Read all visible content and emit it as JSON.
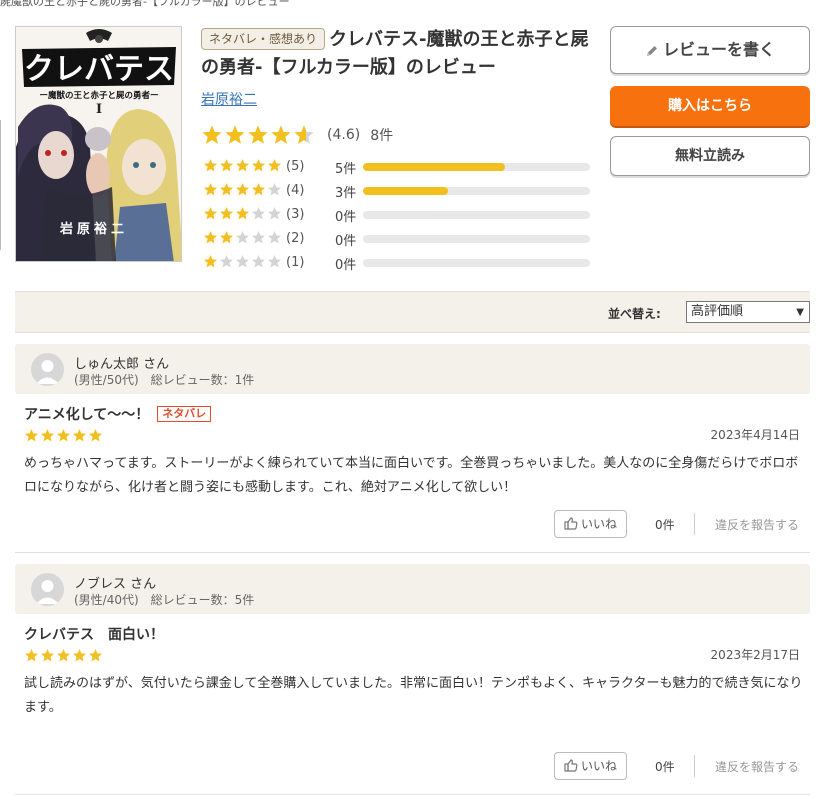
{
  "breadcrumb": "屍魔獣の王と赤子と屍の勇者-【フルカラー版】のレビュー",
  "book": {
    "spoiler_tag": "ネタバレ・感想あり",
    "title": "クレバテス-魔獣の王と赤子と屍の勇者-【フルカラー版】のレビュー",
    "author": "岩原裕二",
    "average": "(4.6)",
    "count": "8件",
    "rating_value": 4.6,
    "cover": {
      "logo": "クレバテス",
      "subtitle": "ー魔獣の王と赤子と屍の勇者ー",
      "volume": "I",
      "author_mark": "岩原裕二"
    }
  },
  "distribution": [
    {
      "stars": 5,
      "label": "(5)",
      "count": "5件",
      "fraction": 0.625
    },
    {
      "stars": 4,
      "label": "(4)",
      "count": "3件",
      "fraction": 0.375
    },
    {
      "stars": 3,
      "label": "(3)",
      "count": "0件",
      "fraction": 0
    },
    {
      "stars": 2,
      "label": "(2)",
      "count": "0件",
      "fraction": 0
    },
    {
      "stars": 1,
      "label": "(1)",
      "count": "0件",
      "fraction": 0
    }
  ],
  "buttons": {
    "write_review": "レビューを書く",
    "buy": "購入はこちら",
    "free_read": "無料立読み"
  },
  "sort": {
    "label": "並べ替え:",
    "selected": "高評価順"
  },
  "reviews": [
    {
      "name": "しゅん太郎 さん",
      "meta": "(男性/50代)　総レビュー数：1件",
      "title": "アニメ化して～～！",
      "tag": "ネタバレ",
      "stars": 5,
      "date": "2023年4月14日",
      "body": "めっちゃハマってます。ストーリーがよく練られていて本当に面白いです。全巻買っちゃいました。美人なのに全身傷だらけでボロボロになりながら、化け者と闘う姿にも感動します。これ、絶対アニメ化して欲しい！",
      "like_label": "いいね",
      "like_count": "0件",
      "report": "違反を報告する"
    },
    {
      "name": "ノブレス さん",
      "meta": "(男性/40代)　総レビュー数：5件",
      "title": "クレバテス　面白い！",
      "tag": "",
      "stars": 5,
      "date": "2023年2月17日",
      "body": "試し読みのはずが、気付いたら課金して全巻購入していました。非常に面白い！テンポもよく、キャラクターも魅力的で続き気になります。",
      "like_label": "いいね",
      "like_count": "0件",
      "report": "違反を報告する"
    }
  ],
  "colors": {
    "star_gold": "#f2c01e",
    "star_empty": "#d4d4d4",
    "buy_orange": "#f7720f",
    "link_blue": "#3774b8",
    "panel_beige": "#f4f1ea"
  }
}
